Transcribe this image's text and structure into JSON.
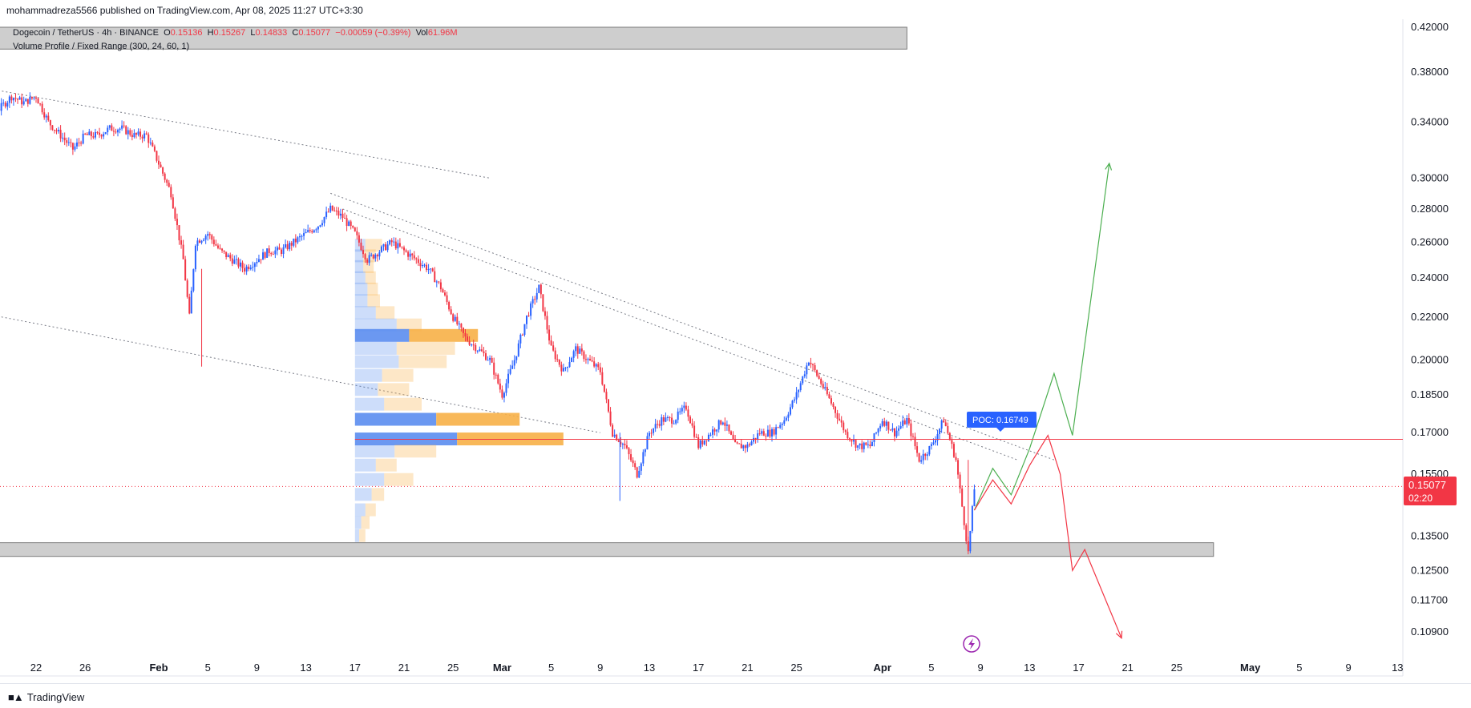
{
  "publisher_line": "mohammadreza5566 published on TradingView.com, Apr 08, 2025 11:27 UTC+3:30",
  "legend": {
    "symbol": "Dogecoin / TetherUS · 4h · BINANCE",
    "o_label": "O",
    "o_value": "0.15136",
    "h_label": "H",
    "h_value": "0.15267",
    "l_label": "L",
    "l_value": "0.14833",
    "c_label": "C",
    "c_value": "0.15077",
    "change": "−0.00059 (−0.39%)",
    "vol_label": "Vol",
    "vol_value": "61.96M",
    "indicator": "Volume Profile / Fixed Range (300, 24, 60, 1)"
  },
  "poc_label": "POC: 0.16749",
  "last_price_label": "0.15077",
  "countdown_label": "02:20",
  "footer_brand": "TradingView",
  "colors": {
    "up": "#2962ff",
    "down": "#f23645",
    "poc_line": "#f23645",
    "vp_up": "#5b8def",
    "vp_down": "#f7b047",
    "zone": "#c9c9c9",
    "bull_path": "#4caf50",
    "bear_path": "#f23645"
  },
  "chart_data": {
    "type": "candlestick",
    "symbol": "DOGE/USDT",
    "timeframe": "4h",
    "y_axis": {
      "scale": "log",
      "ticks": [
        0.42,
        0.38,
        0.34,
        0.3,
        0.28,
        0.26,
        0.24,
        0.22,
        0.2,
        0.185,
        0.17,
        0.155,
        0.135,
        0.125,
        0.117,
        0.109
      ],
      "tick_labels": [
        "0.42000",
        "0.38000",
        "0.34000",
        "0.30000",
        "0.28000",
        "0.26000",
        "0.24000",
        "0.22000",
        "0.20000",
        "0.18500",
        "0.17000",
        "0.15500",
        "0.13500",
        "0.12500",
        "0.11700",
        "0.10900"
      ]
    },
    "x_axis": {
      "tick_labels": [
        "22",
        "26",
        "Feb",
        "5",
        "9",
        "13",
        "17",
        "21",
        "25",
        "Mar",
        "5",
        "9",
        "13",
        "17",
        "21",
        "25",
        "Apr",
        "5",
        "9",
        "13",
        "17",
        "21",
        "25",
        "May",
        "5",
        "9",
        "13"
      ],
      "tick_days": [
        -10,
        -6,
        0,
        4,
        8,
        12,
        16,
        20,
        24,
        28,
        32,
        36,
        40,
        44,
        48,
        52,
        59,
        63,
        67,
        71,
        75,
        79,
        83,
        89,
        93,
        97,
        101
      ]
    },
    "close_path_days": [
      -17,
      -16,
      -15,
      -14,
      -13,
      -12,
      -11,
      -10,
      -9,
      -8,
      -7,
      -6,
      -5,
      -4,
      -3,
      -2,
      -1,
      0,
      1,
      2,
      2.5,
      3,
      4,
      5,
      6,
      7,
      8,
      9,
      10,
      11,
      12,
      13,
      14,
      15,
      16,
      17,
      18,
      19,
      20,
      21,
      22,
      23,
      24,
      25,
      26,
      27,
      28,
      29,
      30,
      31,
      32,
      33,
      34,
      35,
      36,
      37,
      38,
      39,
      40,
      41,
      42,
      43,
      44,
      45,
      46,
      47,
      48,
      49,
      50,
      51,
      52,
      53,
      54,
      55,
      56,
      57,
      58,
      59,
      60,
      61,
      62,
      63,
      64,
      65,
      66,
      66.5
    ],
    "close_path_prices": [
      0.4,
      0.38,
      0.37,
      0.36,
      0.35,
      0.36,
      0.355,
      0.36,
      0.34,
      0.33,
      0.32,
      0.33,
      0.33,
      0.335,
      0.335,
      0.33,
      0.33,
      0.31,
      0.29,
      0.25,
      0.22,
      0.26,
      0.265,
      0.255,
      0.25,
      0.245,
      0.25,
      0.255,
      0.255,
      0.26,
      0.265,
      0.27,
      0.28,
      0.275,
      0.265,
      0.25,
      0.255,
      0.26,
      0.255,
      0.25,
      0.245,
      0.235,
      0.22,
      0.21,
      0.205,
      0.2,
      0.185,
      0.2,
      0.22,
      0.235,
      0.205,
      0.195,
      0.205,
      0.2,
      0.195,
      0.17,
      0.165,
      0.155,
      0.17,
      0.175,
      0.175,
      0.18,
      0.165,
      0.17,
      0.175,
      0.165,
      0.165,
      0.17,
      0.17,
      0.175,
      0.185,
      0.2,
      0.19,
      0.18,
      0.17,
      0.165,
      0.165,
      0.175,
      0.17,
      0.175,
      0.16,
      0.165,
      0.175,
      0.16,
      0.13,
      0.15
    ],
    "close_last": 0.15077,
    "candle_extremes": {
      "high_max": 0.403,
      "low_min": 0.1305,
      "wick_low_feb3": 0.197,
      "wick_low_mar10": 0.146
    },
    "volume_profile": {
      "range_days": [
        16,
        23
      ],
      "rows": [
        {
          "price": 0.258,
          "up": 0.05,
          "down": 0.08
        },
        {
          "price": 0.252,
          "up": 0.04,
          "down": 0.06
        },
        {
          "price": 0.246,
          "up": 0.04,
          "down": 0.05
        },
        {
          "price": 0.24,
          "up": 0.05,
          "down": 0.05
        },
        {
          "price": 0.234,
          "up": 0.06,
          "down": 0.05
        },
        {
          "price": 0.228,
          "up": 0.06,
          "down": 0.06
        },
        {
          "price": 0.222,
          "up": 0.1,
          "down": 0.09
        },
        {
          "price": 0.216,
          "up": 0.2,
          "down": 0.12
        },
        {
          "price": 0.211,
          "up": 0.26,
          "down": 0.33
        },
        {
          "price": 0.205,
          "up": 0.2,
          "down": 0.28
        },
        {
          "price": 0.199,
          "up": 0.21,
          "down": 0.23
        },
        {
          "price": 0.193,
          "up": 0.13,
          "down": 0.15
        },
        {
          "price": 0.187,
          "up": 0.11,
          "down": 0.15
        },
        {
          "price": 0.181,
          "up": 0.14,
          "down": 0.18
        },
        {
          "price": 0.175,
          "up": 0.39,
          "down": 0.4
        },
        {
          "price": 0.16749,
          "up": 0.49,
          "down": 0.51
        },
        {
          "price": 0.163,
          "up": 0.19,
          "down": 0.2
        },
        {
          "price": 0.158,
          "up": 0.1,
          "down": 0.1
        },
        {
          "price": 0.153,
          "up": 0.14,
          "down": 0.14
        },
        {
          "price": 0.148,
          "up": 0.08,
          "down": 0.06
        },
        {
          "price": 0.143,
          "up": 0.05,
          "down": 0.05
        },
        {
          "price": 0.139,
          "up": 0.03,
          "down": 0.04
        },
        {
          "price": 0.135,
          "up": 0.02,
          "down": 0.03
        }
      ],
      "poc": 0.16749
    },
    "trendlines": [
      {
        "name": "upper-downtrend-line",
        "points": [
          [
            -16,
            0.37
          ],
          [
            27,
            0.3
          ]
        ]
      },
      {
        "name": "mid-downtrend-line",
        "points": [
          [
            14,
            0.29
          ],
          [
            73,
            0.16
          ]
        ]
      },
      {
        "name": "inner-downtrend-line",
        "points": [
          [
            15,
            0.28
          ],
          [
            70,
            0.16
          ]
        ]
      },
      {
        "name": "lower-channel-line",
        "points": [
          [
            -17,
            0.225
          ],
          [
            36,
            0.17
          ]
        ]
      }
    ],
    "zones": [
      {
        "name": "top-resistance-zone",
        "from_day": -17,
        "to_day": 61,
        "low": 0.4,
        "high": 0.42
      },
      {
        "name": "bottom-support-zone",
        "from_day": -17,
        "to_day": 86,
        "low": 0.129,
        "high": 0.133
      }
    ],
    "projections": {
      "bullish": {
        "days": [
          66.5,
          68,
          69.5,
          71,
          73,
          74.5,
          77.5
        ],
        "prices": [
          0.143,
          0.157,
          0.148,
          0.164,
          0.194,
          0.169,
          0.31
        ]
      },
      "bearish": {
        "days": [
          66.5,
          68,
          69.5,
          71,
          72.5,
          73.5,
          74.5,
          75.5,
          78.5
        ],
        "prices": [
          0.143,
          0.153,
          0.145,
          0.158,
          0.169,
          0.155,
          0.125,
          0.131,
          0.1075
        ]
      }
    }
  }
}
